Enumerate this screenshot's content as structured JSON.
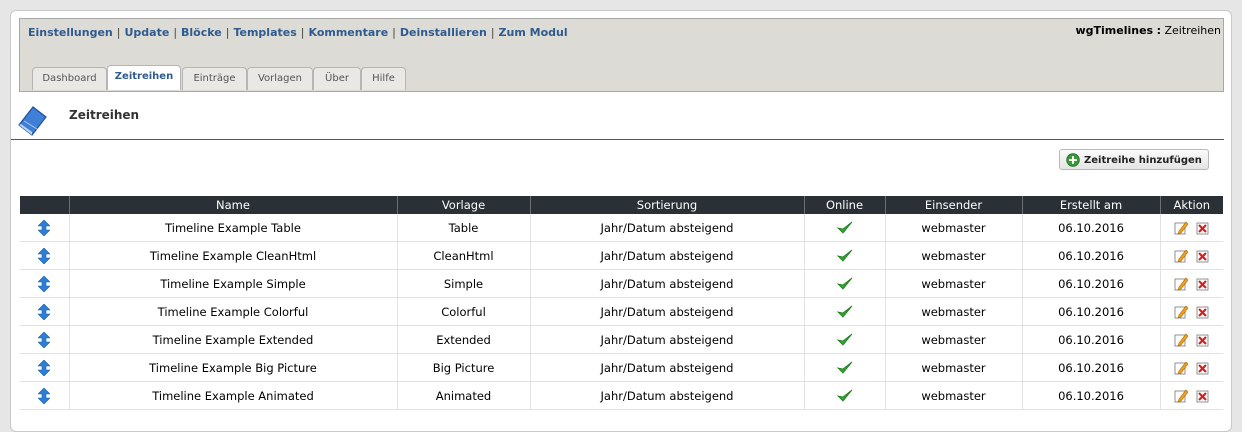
{
  "topnav": {
    "links": [
      "Einstellungen",
      "Update",
      "Blöcke",
      "Templates",
      "Kommentare",
      "Deinstallieren",
      "Zum Modul"
    ],
    "separator": "|"
  },
  "breadcrumb": {
    "module": "wgTimelines",
    "separator": ":",
    "page": "Zeitreihen"
  },
  "tabs": [
    "Dashboard",
    "Zeitreihen",
    "Einträge",
    "Vorlagen",
    "Über",
    "Hilfe"
  ],
  "active_tab": "Zeitreihen",
  "page_title": "Zeitreihen",
  "add_button": "Zeitreihe hinzufügen",
  "table": {
    "headers": [
      "Name",
      "Vorlage",
      "Sortierung",
      "Online",
      "Einsender",
      "Erstellt am",
      "Aktion"
    ],
    "rows": [
      {
        "name": "Timeline Example Table",
        "template": "Table",
        "sort": "Jahr/Datum absteigend",
        "online": true,
        "submitter": "webmaster",
        "created": "06.10.2016"
      },
      {
        "name": "Timeline Example CleanHtml",
        "template": "CleanHtml",
        "sort": "Jahr/Datum absteigend",
        "online": true,
        "submitter": "webmaster",
        "created": "06.10.2016"
      },
      {
        "name": "Timeline Example Simple",
        "template": "Simple",
        "sort": "Jahr/Datum absteigend",
        "online": true,
        "submitter": "webmaster",
        "created": "06.10.2016"
      },
      {
        "name": "Timeline Example Colorful",
        "template": "Colorful",
        "sort": "Jahr/Datum absteigend",
        "online": true,
        "submitter": "webmaster",
        "created": "06.10.2016"
      },
      {
        "name": "Timeline Example Extended",
        "template": "Extended",
        "sort": "Jahr/Datum absteigend",
        "online": true,
        "submitter": "webmaster",
        "created": "06.10.2016"
      },
      {
        "name": "Timeline Example Big Picture",
        "template": "Big Picture",
        "sort": "Jahr/Datum absteigend",
        "online": true,
        "submitter": "webmaster",
        "created": "06.10.2016"
      },
      {
        "name": "Timeline Example Animated",
        "template": "Animated",
        "sort": "Jahr/Datum absteigend",
        "online": true,
        "submitter": "webmaster",
        "created": "06.10.2016"
      }
    ]
  },
  "colors": {
    "link": "#2f5b8f",
    "header_bg": "#dddbd6",
    "table_head": "#2b2f36",
    "online": "#2ea82e",
    "delete": "#d42020"
  },
  "icons": {
    "page": "book-icon",
    "add": "plus-circle-icon",
    "sort": "updown-arrow-icon",
    "online": "check-icon",
    "edit": "edit-icon",
    "delete": "delete-icon"
  }
}
